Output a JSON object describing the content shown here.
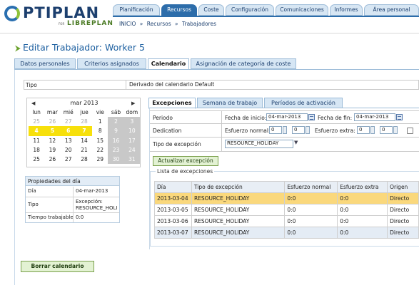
{
  "logo": {
    "brand": "PTIPLAN",
    "for": "FOR",
    "partner": "LIBREPLAN"
  },
  "nav": {
    "tabs": [
      {
        "label": "Planificación"
      },
      {
        "label": "Recursos"
      },
      {
        "label": "Coste"
      },
      {
        "label": "Configuración"
      },
      {
        "label": "Comunicaciones"
      },
      {
        "label": "Informes"
      },
      {
        "label": "Área personal"
      }
    ],
    "active": "Recursos"
  },
  "breadcrumb": [
    "INICIO",
    "»",
    "Recursos",
    "»",
    "Trabajadores"
  ],
  "page": {
    "title": "Editar Trabajador: Worker 5"
  },
  "main_tabs": [
    {
      "label": "Datos personales"
    },
    {
      "label": "Criterios asignados"
    },
    {
      "label": "Calendario"
    },
    {
      "label": "Asignación de categoría de coste"
    }
  ],
  "tipo": {
    "label": "Tipo",
    "value": "Derivado del calendario Default"
  },
  "calendar": {
    "month": "mar 2013",
    "weekdays": [
      "lun",
      "mar",
      "mié",
      "jue",
      "vie",
      "sáb",
      "dom"
    ],
    "weeks": [
      [
        "25",
        "26",
        "27",
        "28",
        "1",
        "2",
        "3"
      ],
      [
        "4",
        "5",
        "6",
        "7",
        "8",
        "9",
        "10"
      ],
      [
        "11",
        "12",
        "13",
        "14",
        "15",
        "16",
        "17"
      ],
      [
        "18",
        "19",
        "20",
        "21",
        "22",
        "23",
        "24"
      ],
      [
        "25",
        "26",
        "27",
        "28",
        "29",
        "30",
        "31"
      ]
    ]
  },
  "day_props": {
    "title": "Propiedades del día",
    "rows": [
      {
        "key": "Día",
        "value": "04-mar-2013"
      },
      {
        "key": "Tipo",
        "value": "Excepción: RESOURCE_HOLI"
      },
      {
        "key": "Tiempo trabajable",
        "value": "0:0"
      }
    ]
  },
  "buttons": {
    "delete_calendar": "Borrar calendario",
    "update_exception": "Actualizar excepción"
  },
  "sub_tabs": [
    {
      "label": "Excepciones"
    },
    {
      "label": "Semana de trabajo"
    },
    {
      "label": "Períodos de activación"
    }
  ],
  "form": {
    "period_label": "Periodo",
    "start_label": "Fecha de inicio:",
    "start_value": "04-mar-2013",
    "end_label": "Fecha de fin:",
    "end_value": "04-mar-2013",
    "dedication_label": "Dedication",
    "normal_label": "Esfuerzo normal:",
    "normal_h": "0",
    "normal_m": "0",
    "extra_label": "Esfuerzo extra:",
    "extra_h": "0",
    "extra_m": "0",
    "type_label": "Tipo de excepción",
    "type_value": "RESOURCE_HOLIDAY"
  },
  "exceptions": {
    "legend": "Lista de excepciones",
    "columns": [
      "Día",
      "Tipo de excepción",
      "Esfuerzo normal",
      "Esfuerzo extra",
      "Origen"
    ],
    "rows": [
      [
        "2013-03-04",
        "RESOURCE_HOLIDAY",
        "0:0",
        "0:0",
        "Directo"
      ],
      [
        "2013-03-05",
        "RESOURCE_HOLIDAY",
        "0:0",
        "0:0",
        "Directo"
      ],
      [
        "2013-03-06",
        "RESOURCE_HOLIDAY",
        "0:0",
        "0:0",
        "Directo"
      ],
      [
        "2013-03-07",
        "RESOURCE_HOLIDAY",
        "0:0",
        "0:0",
        "Directo"
      ]
    ]
  }
}
